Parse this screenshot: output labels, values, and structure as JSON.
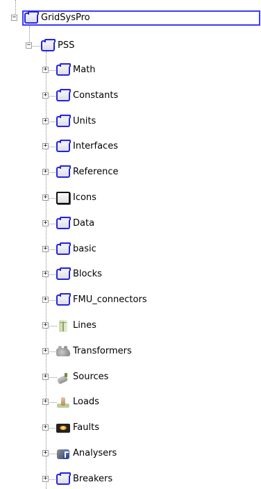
{
  "tree": {
    "root": {
      "label": "GridSysPro",
      "icon": "package-icon",
      "expander": "−",
      "selected": true
    },
    "child": {
      "label": "PSS",
      "icon": "package-icon",
      "expander": "−"
    },
    "items": [
      {
        "label": "Math",
        "icon": "package-icon",
        "expander": "+"
      },
      {
        "label": "Constants",
        "icon": "package-icon",
        "expander": "+"
      },
      {
        "label": "Units",
        "icon": "package-icon",
        "expander": "+"
      },
      {
        "label": "Interfaces",
        "icon": "package-icon",
        "expander": "+"
      },
      {
        "label": "Reference",
        "icon": "package-icon",
        "expander": "+"
      },
      {
        "label": "Icons",
        "icon": "icons-package-icon",
        "expander": "+"
      },
      {
        "label": "Data",
        "icon": "package-icon",
        "expander": "+"
      },
      {
        "label": "basic",
        "icon": "package-icon",
        "expander": "+"
      },
      {
        "label": "Blocks",
        "icon": "package-icon",
        "expander": "+"
      },
      {
        "label": "FMU_connectors",
        "icon": "package-icon",
        "expander": "+"
      },
      {
        "label": "Lines",
        "icon": "lines-icon",
        "expander": "+"
      },
      {
        "label": "Transformers",
        "icon": "transformer-icon",
        "expander": "+"
      },
      {
        "label": "Sources",
        "icon": "source-icon",
        "expander": "+"
      },
      {
        "label": "Loads",
        "icon": "load-icon",
        "expander": "+"
      },
      {
        "label": "Faults",
        "icon": "fault-icon",
        "expander": "+"
      },
      {
        "label": "Analysers",
        "icon": "analyser-icon",
        "expander": "+"
      },
      {
        "label": "Breakers",
        "icon": "package-icon",
        "expander": "+"
      }
    ]
  },
  "colors": {
    "selection_border": "#3b3bf5",
    "package_border": "#2323e0",
    "connector": "#8a8a8a"
  }
}
